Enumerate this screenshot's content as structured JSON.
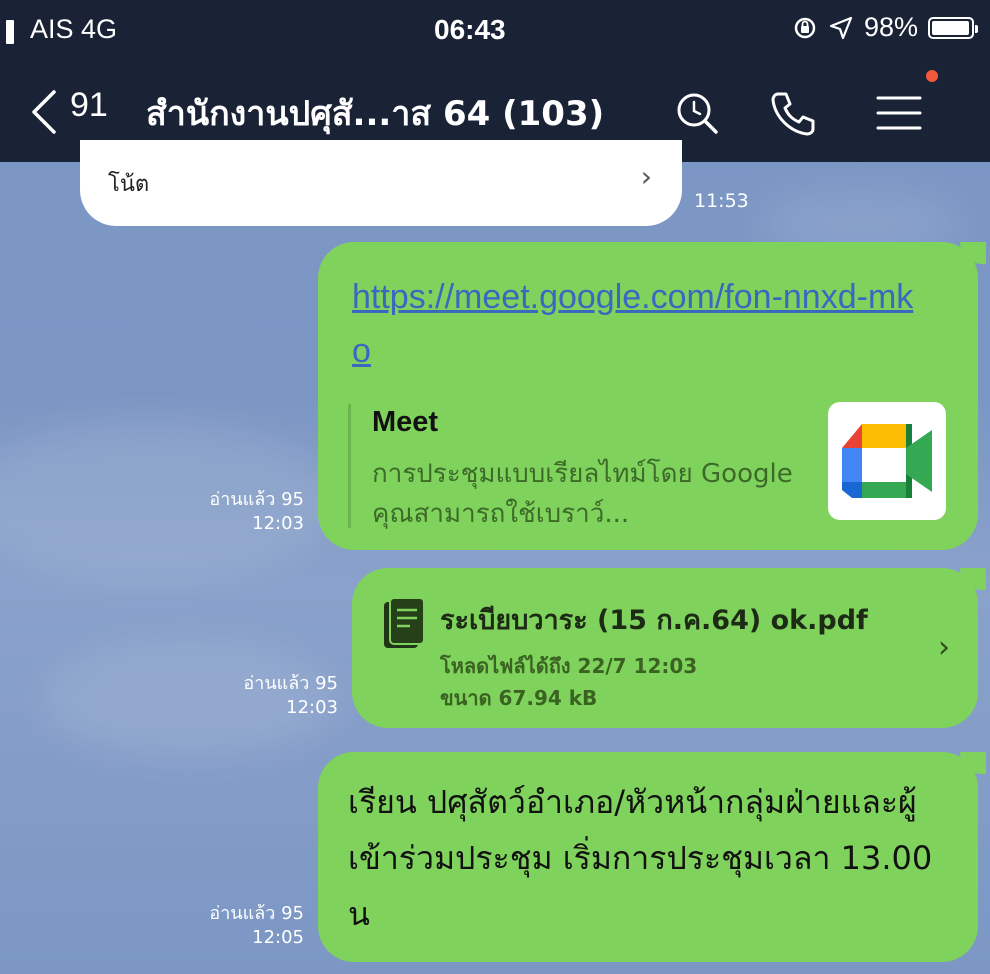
{
  "status_bar": {
    "carrier": "AIS 4G",
    "time": "06:43",
    "battery": "98%",
    "battery_level": 0.98
  },
  "header": {
    "unread_count": "91",
    "title": "สำนักงานปศุสั...าส 64 (103)"
  },
  "messages": {
    "previous": {
      "note": "โน้ต",
      "time": "11:53"
    },
    "link_message": {
      "url": "https://meet.google.com/fon-nnxd-mko",
      "preview_title": "Meet",
      "preview_description": "การประชุมแบบเรียลไทม์โดย Google คุณสามารถใช้เบราว์...",
      "read": "อ่านแล้ว 95",
      "time": "12:03"
    },
    "file_message": {
      "file_name": "ระเบียบวาระ  (15 ก.ค.64) ok.pdf",
      "expires": "โหลดไฟล์ได้ถึง 22/7 12:03",
      "size": "ขนาด 67.94 kB",
      "read": "อ่านแล้ว 95",
      "time": "12:03"
    },
    "text_message": {
      "text": "เรียน ปศุสัตว์อำเภอ/หัวหน้ากลุ่มฝ่ายและผู้เข้าร่วมประชุม  เริ่มการประชุมเวลา 13.00 น",
      "read": "อ่านแล้ว 95",
      "time": "12:05"
    }
  },
  "colors": {
    "header_bg": "#1a2336",
    "bubble_green": "#7fd35c",
    "link": "#3c67c0",
    "chat_bg": "#7d98c6",
    "notif_dot": "#f0593b"
  },
  "icons": {
    "back": "chevron-left-icon",
    "search": "search-icon",
    "call": "phone-icon",
    "menu": "menu-icon",
    "file": "document-icon",
    "meet": "google-meet-logo"
  }
}
